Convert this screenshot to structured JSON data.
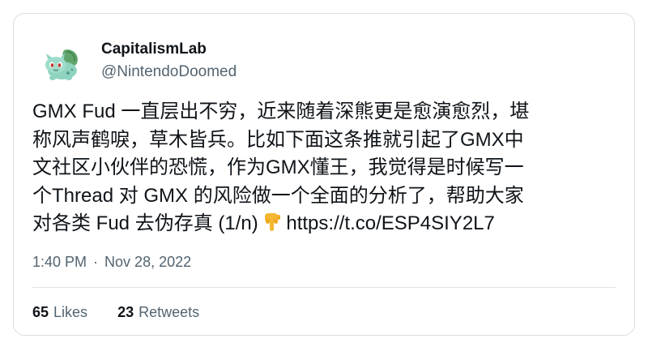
{
  "author": {
    "name": "CapitalismLab",
    "handle": "@NintendoDoomed"
  },
  "tweet": {
    "lines": [
      "GMX Fud 一直层出不穷，近来随着深熊更是愈演愈烈，堪",
      "称风声鹤唳，草木皆兵。比如下面这条推就引起了GMX中",
      "文社区小伙伴的恐慌，作为GMX懂王，我觉得是时候写一",
      "个Thread 对 GMX 的风险做一个全面的分析了，帮助大家"
    ],
    "last_line_text": "对各类 Fud 去伪存真 (1/n) ",
    "emoji_icon": "backhand-index-pointing-down-icon",
    "link": "https://t.co/ESP4SIY2L7"
  },
  "meta": {
    "time": "1:40 PM",
    "separator": "·",
    "date": "Nov 28, 2022"
  },
  "stats": {
    "likes_count": "65",
    "likes_label": "Likes",
    "retweets_count": "23",
    "retweets_label": "Retweets"
  },
  "colors": {
    "text": "#0f1419",
    "secondary": "#536471",
    "border": "#d9dde1"
  }
}
